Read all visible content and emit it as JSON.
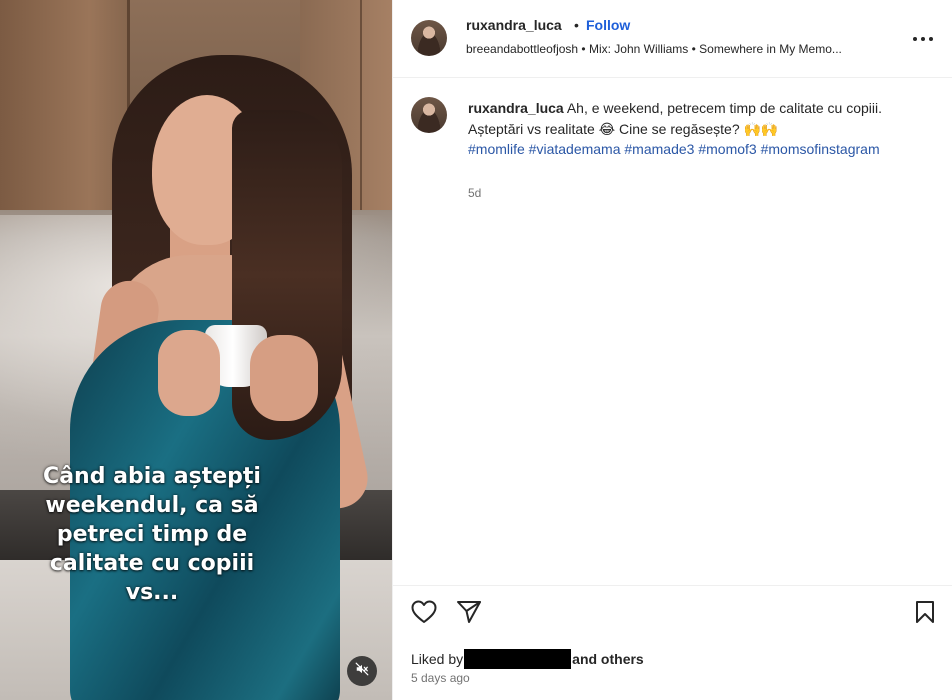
{
  "media": {
    "overlay_caption_lines": [
      "Când abia aștepți",
      "weekendul, ca să",
      "petreci timp de",
      "calitate cu copiii",
      "vs..."
    ]
  },
  "header": {
    "username": "ruxandra_luca",
    "separator": "•",
    "follow_label": "Follow",
    "audio_line": "breeandabottleofjosh • Mix: John Williams • Somewhere in My Memo..."
  },
  "caption": {
    "username": "ruxandra_luca",
    "text": "Ah, e weekend, petrecem timp de calitate cu copiii. Așteptări vs realitate 😂 Cine se regăsește? 🙌🙌",
    "hashtags": "#momlife #viatademama #mamade3 #momof3 #momsofinstagram",
    "time": "5d"
  },
  "footer": {
    "liked_by_prefix": "Liked by",
    "liked_by_suffix": "and others",
    "date": "5 days ago"
  },
  "colors": {
    "link": "#1e5fd9",
    "hashtag": "#2b57a6",
    "muted": "#737373"
  }
}
